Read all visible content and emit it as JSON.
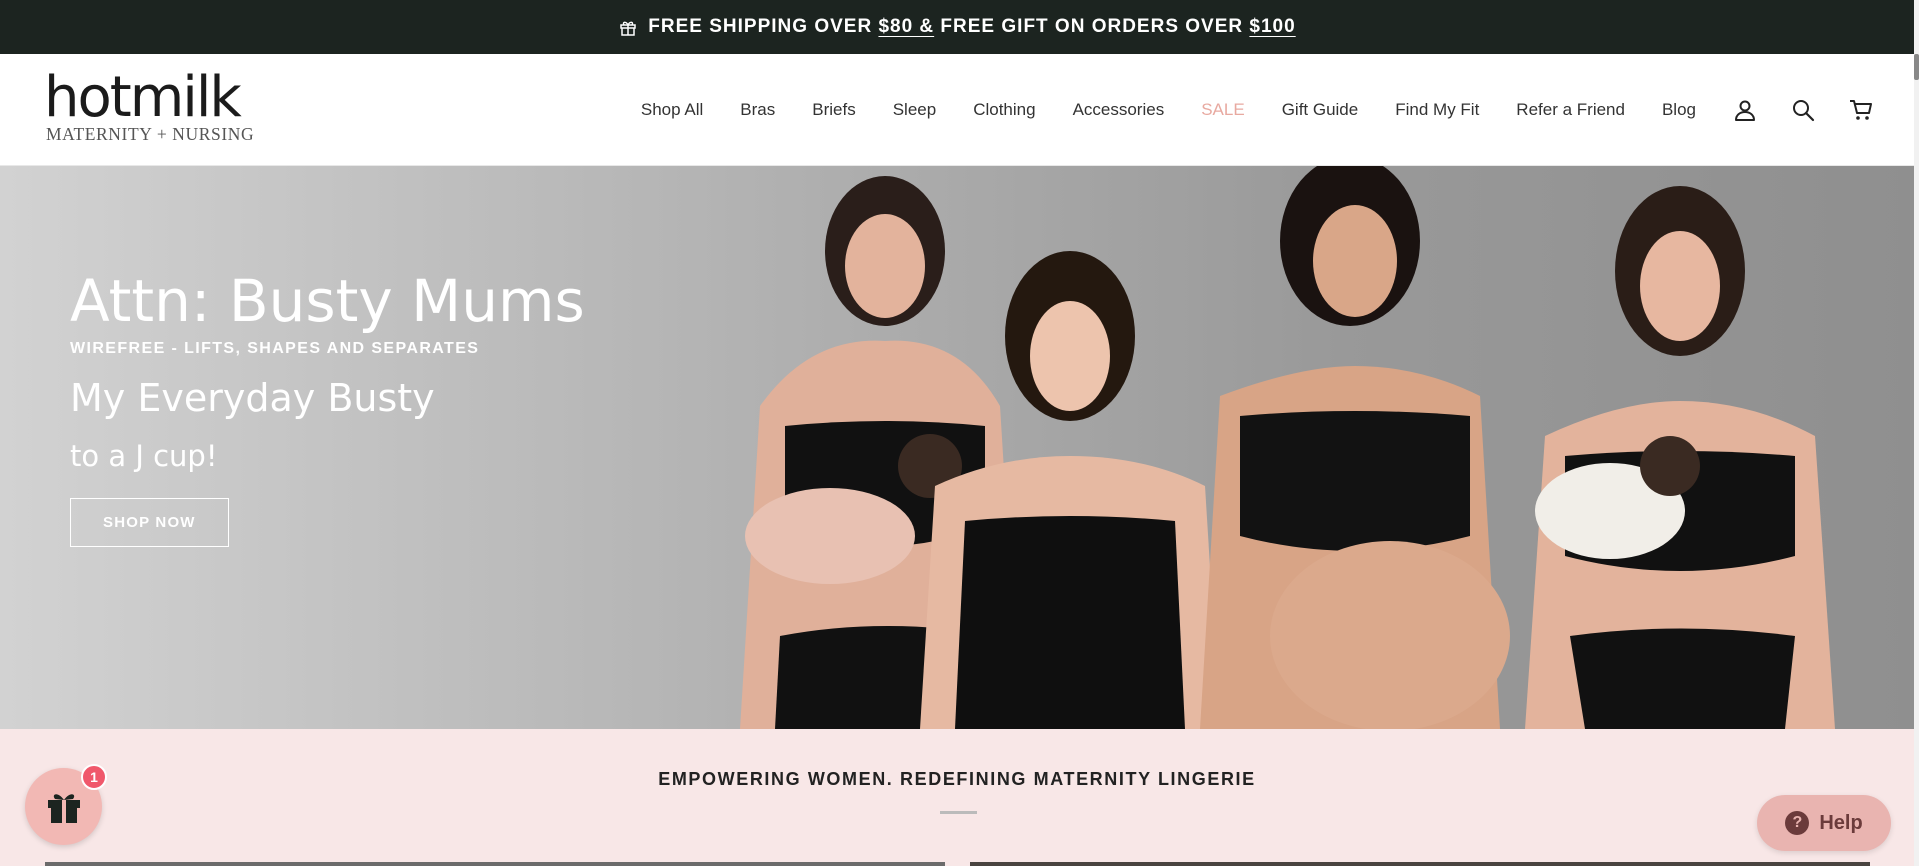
{
  "announcement": {
    "part1": "FREE SHIPPING OVER ",
    "amount1": "$80 &",
    "part2": " FREE GIFT ON ORDERS OVER ",
    "amount2": "$100",
    "icon": "gift-box-icon"
  },
  "header": {
    "logo_brand": "hotmilk",
    "logo_tagline": "MATERNITY + NURSING",
    "nav": [
      {
        "label": "Shop All"
      },
      {
        "label": "Bras"
      },
      {
        "label": "Briefs"
      },
      {
        "label": "Sleep"
      },
      {
        "label": "Clothing"
      },
      {
        "label": "Accessories"
      },
      {
        "label": "SALE"
      },
      {
        "label": "Gift Guide"
      },
      {
        "label": "Find My Fit"
      },
      {
        "label": "Refer a Friend"
      },
      {
        "label": "Blog"
      }
    ],
    "icons": [
      "account-icon",
      "search-icon",
      "cart-icon"
    ],
    "sale_color": "#e8a9a0"
  },
  "hero": {
    "title": "Attn: Busty Mums",
    "subtitle": "WIREFREE - LIFTS, SHAPES AND SEPARATES",
    "heading": "My Everyday Busty",
    "subheading": "to a J cup!",
    "button": "SHOP NOW"
  },
  "section": {
    "title": "EMPOWERING WOMEN. REDEFINING MATERNITY LINGERIE",
    "background": "#f8e7e7"
  },
  "widgets": {
    "gift_badge_count": "1",
    "help_label": "Help"
  },
  "colors": {
    "announcement_bg": "#1c2420",
    "accent_pink": "#f2b8b4",
    "badge_red": "#f0586b"
  }
}
